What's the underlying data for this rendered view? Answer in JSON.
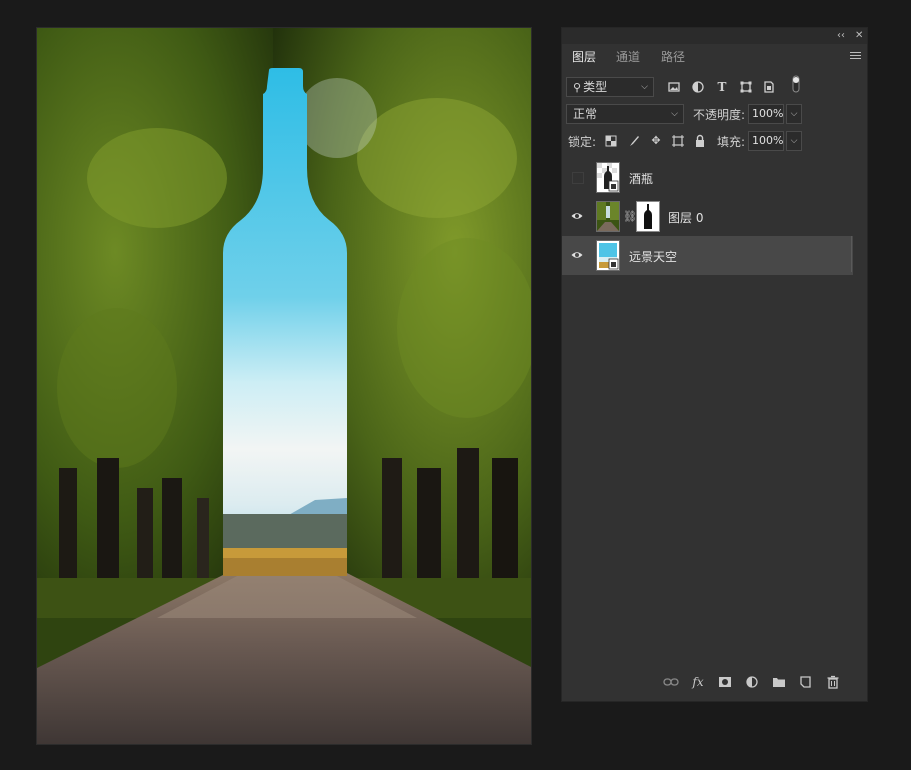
{
  "panel": {
    "controls": {
      "collapse": "‹‹",
      "close": "✕"
    },
    "tabs": [
      {
        "label": "图层",
        "active": true
      },
      {
        "label": "通道",
        "active": false
      },
      {
        "label": "路径",
        "active": false
      }
    ],
    "filter": {
      "label": "类型"
    },
    "blend_mode": "正常",
    "opacity": {
      "label": "不透明度:",
      "value": "100%"
    },
    "lock": {
      "label": "锁定:"
    },
    "fill": {
      "label": "填充:",
      "value": "100%"
    },
    "layers": [
      {
        "name": "酒瓶",
        "visible": false,
        "selected": false
      },
      {
        "name": "图层 0",
        "visible": true,
        "selected": false
      },
      {
        "name": "远景天空",
        "visible": true,
        "selected": true
      }
    ]
  },
  "colors": {
    "panel_bg": "#323232",
    "selected_row": "#484848",
    "sky": "#4ec4e6"
  },
  "icons": {
    "filter_icons": [
      "image-filter-icon",
      "adjustment-filter-icon",
      "type-filter-icon",
      "shape-filter-icon",
      "smart-object-filter-icon"
    ],
    "lock_icons": [
      "lock-transparent-icon",
      "lock-image-icon",
      "lock-position-icon",
      "lock-artboard-icon",
      "lock-all-icon"
    ],
    "bottom_icons": [
      "link-layers-icon",
      "fx-icon",
      "add-mask-icon",
      "adjustment-layer-icon",
      "group-folder-icon",
      "new-layer-icon",
      "delete-icon"
    ]
  }
}
